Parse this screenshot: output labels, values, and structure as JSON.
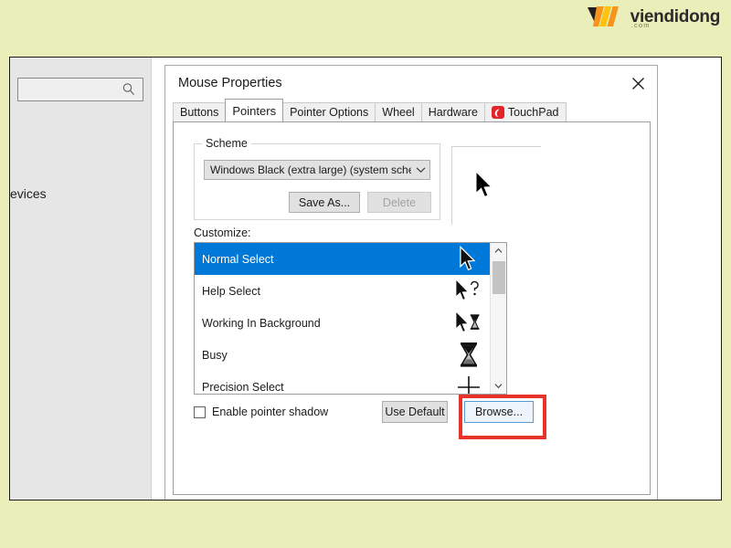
{
  "brand": {
    "name": "viendidong",
    "suffix": ".com",
    "logo_icon": "viendidong-logo-icon",
    "colors": {
      "dark": "#231f20",
      "orange": "#f07d1a",
      "yellow": "#ffc20e"
    }
  },
  "background_window": {
    "search_placeholder": "",
    "search_icon": "search-icon",
    "visible_text": "evices"
  },
  "dialog": {
    "title": "Mouse Properties",
    "close_icon": "close-icon",
    "tabs": [
      {
        "label": "Buttons",
        "active": false,
        "icon": null
      },
      {
        "label": "Pointers",
        "active": true,
        "icon": null
      },
      {
        "label": "Pointer Options",
        "active": false,
        "icon": null
      },
      {
        "label": "Wheel",
        "active": false,
        "icon": null
      },
      {
        "label": "Hardware",
        "active": false,
        "icon": null
      },
      {
        "label": "TouchPad",
        "active": false,
        "icon": "touchpad-icon"
      }
    ],
    "scheme": {
      "legend": "Scheme",
      "selected_value": "Windows Black (extra large) (system scheme)",
      "dropdown_icon": "chevron-down-icon",
      "save_as_label": "Save As...",
      "delete_label": "Delete",
      "delete_disabled": true
    },
    "preview": {
      "cursor_icon": "arrow-cursor-icon"
    },
    "customize": {
      "label": "Customize:",
      "items": [
        {
          "label": "Normal Select",
          "selected": true,
          "cursor_icon": "arrow-cursor-icon"
        },
        {
          "label": "Help Select",
          "selected": false,
          "cursor_icon": "arrow-help-cursor-icon"
        },
        {
          "label": "Working In Background",
          "selected": false,
          "cursor_icon": "arrow-hourglass-cursor-icon"
        },
        {
          "label": "Busy",
          "selected": false,
          "cursor_icon": "hourglass-cursor-icon"
        },
        {
          "label": "Precision Select",
          "selected": false,
          "cursor_icon": "crosshair-cursor-icon"
        }
      ],
      "scroll_up_icon": "chevron-up-icon",
      "scroll_down_icon": "chevron-down-icon"
    },
    "footer": {
      "checkbox_label": "Enable pointer shadow",
      "checkbox_checked": false,
      "use_default_label": "Use Default",
      "browse_label": "Browse...",
      "highlight_color": "#e8332a"
    }
  },
  "theme": {
    "page_background": "#eaeeb9",
    "selection_blue": "#0078d7"
  }
}
